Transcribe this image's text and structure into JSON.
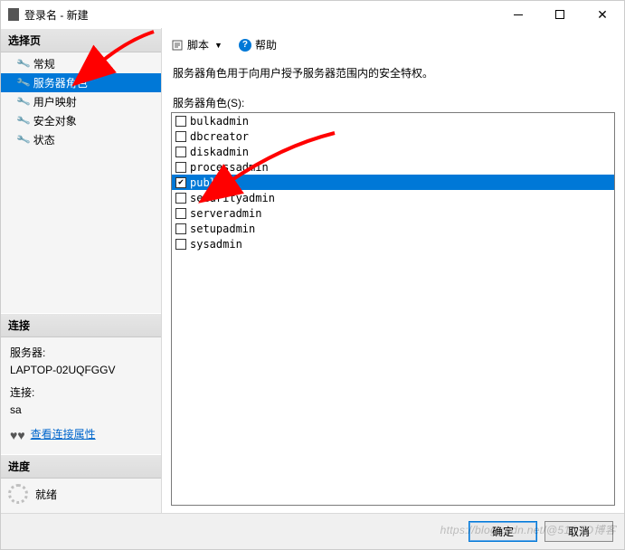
{
  "window": {
    "title": "登录名 - 新建"
  },
  "sidebar": {
    "select_header": "选择页",
    "items": [
      {
        "label": "常规"
      },
      {
        "label": "服务器角色"
      },
      {
        "label": "用户映射"
      },
      {
        "label": "安全对象"
      },
      {
        "label": "状态"
      }
    ],
    "connection_header": "连接",
    "connection": {
      "server_label": "服务器:",
      "server_value": "LAPTOP-02UQFGGV",
      "conn_label": "连接:",
      "conn_value": "sa",
      "view_link": "查看连接属性"
    },
    "progress_header": "进度",
    "progress_status": "就绪"
  },
  "toolbar": {
    "script_label": "脚本",
    "help_label": "帮助"
  },
  "content": {
    "description": "服务器角色用于向用户授予服务器范围内的安全特权。",
    "list_label": "服务器角色(S):",
    "roles": [
      {
        "name": "bulkadmin",
        "checked": false,
        "selected": false
      },
      {
        "name": "dbcreator",
        "checked": false,
        "selected": false
      },
      {
        "name": "diskadmin",
        "checked": false,
        "selected": false
      },
      {
        "name": "processadmin",
        "checked": false,
        "selected": false
      },
      {
        "name": "public",
        "checked": true,
        "selected": true
      },
      {
        "name": "securityadmin",
        "checked": false,
        "selected": false
      },
      {
        "name": "serveradmin",
        "checked": false,
        "selected": false
      },
      {
        "name": "setupadmin",
        "checked": false,
        "selected": false
      },
      {
        "name": "sysadmin",
        "checked": false,
        "selected": false
      }
    ]
  },
  "footer": {
    "ok_label": "确定",
    "cancel_label": "取消"
  },
  "watermark": "https://blog.csdn.net/@51CTO博客",
  "colors": {
    "selection": "#0078d7",
    "arrow": "#ff0000"
  }
}
